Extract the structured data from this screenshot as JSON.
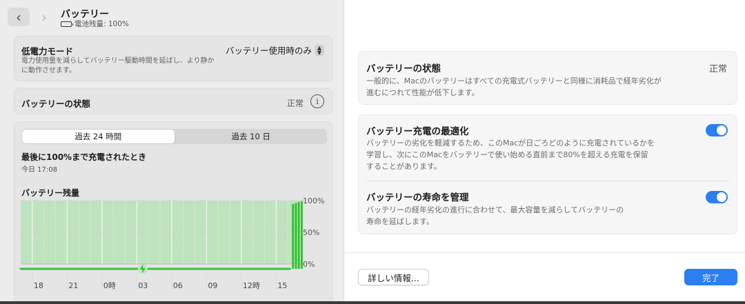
{
  "left": {
    "title": "バッテリー",
    "battery_status": "電池残量: 100%",
    "low_power": {
      "title": "低電力モード",
      "description": "電力使用量を減らしてバッテリー駆動時間を延ばし、より静かに動作させます。",
      "selected": "バッテリー使用時のみ"
    },
    "state": {
      "title": "バッテリーの状態",
      "value": "正常"
    },
    "tabs": [
      "過去 24 時間",
      "過去 10 日"
    ],
    "active_tab": 0,
    "last_charged_title": "最後に100%まで充電されたとき",
    "last_charged_time": "今日 17:08",
    "level_title": "バッテリー残量"
  },
  "chart_data": {
    "type": "bar",
    "categories": [
      "18",
      "21",
      "0時",
      "03",
      "06",
      "09",
      "12時",
      "15"
    ],
    "y_ticks": [
      "100%",
      "50%",
      "0%"
    ],
    "ylim": [
      0,
      100
    ],
    "x_range_hours": [
      17,
      41
    ],
    "charging_start_hour": 40.2,
    "full_charge_bars_hours": [
      40.45,
      40.7,
      40.95,
      41.2
    ],
    "colors": {
      "fill": "#bfe3bf",
      "grid": "#ffffff",
      "bar": "#2ec22e",
      "line": "#3cc03c"
    }
  },
  "right": {
    "state": {
      "title": "バッテリーの状態",
      "value": "正常",
      "description_lines": [
        "一般的に、Macのバッテリーはすべての充電式バッテリーと同様に消耗品で経年劣化が",
        "進むにつれて性能が低下します。"
      ]
    },
    "optimize": {
      "title": "バッテリー充電の最適化",
      "description_lines": [
        "バッテリーの劣化を軽減するため、このMacが日ごろどのように充電されているかを",
        "学習し、次にこのMacをバッテリーで使い始める直前まで80%を超える充電を保留",
        "することがあります。"
      ],
      "enabled": true
    },
    "health": {
      "title": "バッテリーの寿命を管理",
      "description_lines": [
        "バッテリーの経年劣化の進行に合わせて、最大容量を減らしてバッテリーの",
        "寿命を延ばします。"
      ],
      "enabled": true
    },
    "more_info_label": "詳しい情報...",
    "done_label": "完了"
  },
  "colors": {
    "accent": "#2b7ff0"
  }
}
